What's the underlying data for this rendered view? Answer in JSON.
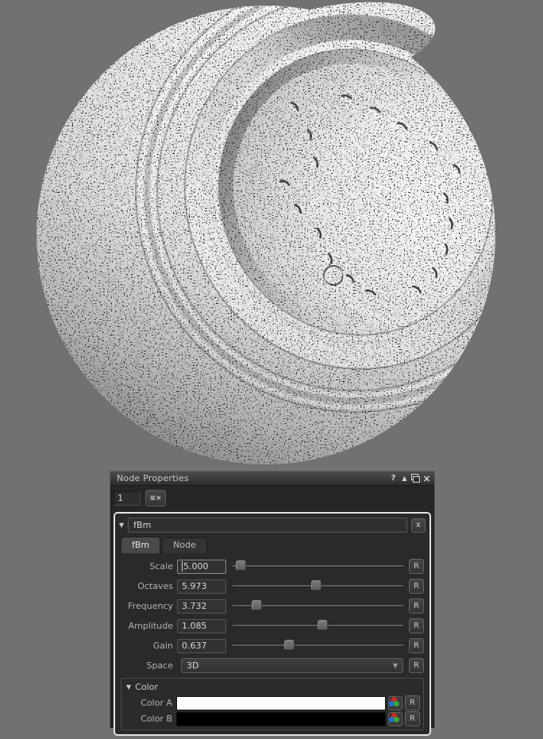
{
  "window": {
    "title": "Node Properties",
    "titlebar_icons": [
      {
        "name": "help",
        "glyph": "?"
      },
      {
        "name": "pin",
        "glyph": "▲"
      },
      {
        "name": "popout",
        "glyph": ""
      },
      {
        "name": "close",
        "glyph": "×"
      }
    ],
    "index_value": "1",
    "clear_button_glyph": "≡×"
  },
  "node": {
    "collapse_glyph": "▼",
    "name": "fBm",
    "close_glyph": "x",
    "reset_label": "R",
    "tabs": [
      {
        "label": "fBm",
        "active": true
      },
      {
        "label": "Node",
        "active": false
      }
    ],
    "params": [
      {
        "label": "Scale",
        "value": "5.000",
        "slider_pct": 2
      },
      {
        "label": "Octaves",
        "value": "5.973",
        "slider_pct": 49
      },
      {
        "label": "Frequency",
        "value": "3.732",
        "slider_pct": 12
      },
      {
        "label": "Amplitude",
        "value": "1.085",
        "slider_pct": 53
      },
      {
        "label": "Gain",
        "value": "0.637",
        "slider_pct": 32
      }
    ],
    "space": {
      "label": "Space",
      "value": "3D",
      "arrow_glyph": "▼"
    },
    "color_section": {
      "collapse_glyph": "▼",
      "header": "Color",
      "rows": [
        {
          "label": "Color A",
          "color": "#ffffff"
        },
        {
          "label": "Color B",
          "color": "#000000"
        }
      ]
    }
  },
  "preview": {
    "background_color": "#717171"
  }
}
